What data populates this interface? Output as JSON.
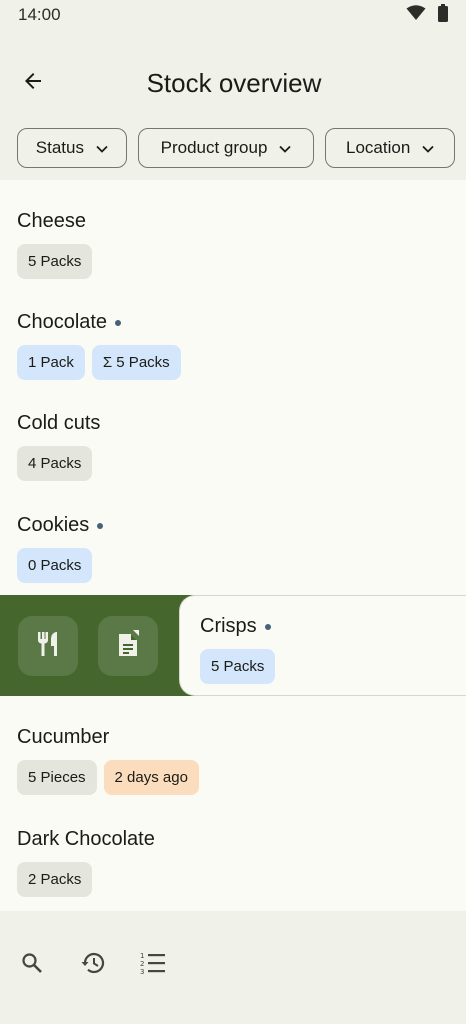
{
  "status_bar": {
    "time": "14:00",
    "icons": [
      "wifi-icon",
      "battery-icon"
    ]
  },
  "header": {
    "title": "Stock overview",
    "back_icon": "arrow-back-icon"
  },
  "filters": [
    {
      "label": "Status",
      "icon": "chevron-down-icon"
    },
    {
      "label": "Product group",
      "icon": "chevron-down-icon"
    },
    {
      "label": "Location",
      "icon": "chevron-down-icon"
    }
  ],
  "items": [
    {
      "name": "Cheese",
      "badges": [
        {
          "text": "5 Packs"
        }
      ]
    },
    {
      "name": "Chocolate",
      "badges": [
        {
          "text": "1 Pack"
        },
        {
          "text": "Σ 5 Packs"
        }
      ]
    },
    {
      "name": "Cold cuts",
      "badges": [
        {
          "text": "4 Packs"
        }
      ]
    },
    {
      "name": "Cookies",
      "badges": [
        {
          "text": "0 Packs"
        }
      ]
    },
    {
      "name": "Crisps",
      "badges": [
        {
          "text": "5 Packs"
        }
      ]
    },
    {
      "name": "Cucumber",
      "badges": [
        {
          "text": "5 Pieces"
        },
        {
          "text": "2 days ago"
        }
      ]
    },
    {
      "name": "Dark Chocolate",
      "badges": [
        {
          "text": "2 Packs"
        }
      ]
    }
  ],
  "swipe_actions": [
    "cutlery-icon",
    "open-product-icon"
  ],
  "bottom_bar": [
    "search-icon",
    "history-icon",
    "list-numbered-icon"
  ],
  "colors": {
    "background": "#f0f1e9",
    "list_background": "#fbfbf5",
    "badge_grey": "#e4e5dc",
    "badge_blue": "#d4e6fb",
    "badge_orange": "#fbdcbc",
    "swipe_green": "#45672d",
    "dot": "#476178"
  }
}
